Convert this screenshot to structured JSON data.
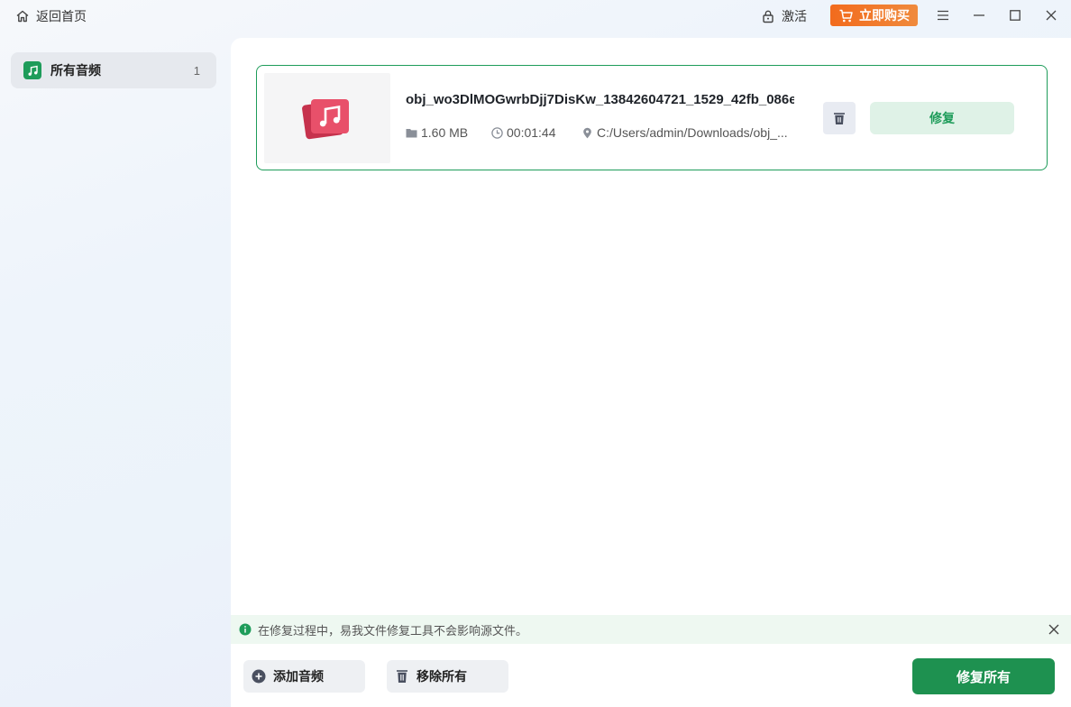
{
  "titlebar": {
    "home_label": "返回首页",
    "activate_label": "激活",
    "buy_label": "立即购买"
  },
  "sidebar": {
    "items": [
      {
        "label": "所有音频",
        "count": "1",
        "icon": "music-note-icon"
      }
    ]
  },
  "files": [
    {
      "name": "obj_wo3DlMOGwrbDjj7DisKw_13842604721_1529_42fb_086e",
      "size": "1.60 MB",
      "duration": "00:01:44",
      "path": "C:/Users/admin/Downloads/obj_...",
      "repair_label": "修复"
    }
  ],
  "info_bar": {
    "text": "在修复过程中，易我文件修复工具不会影响源文件。"
  },
  "actions": {
    "add_label": "添加音频",
    "remove_all_label": "移除所有",
    "repair_all_label": "修复所有"
  },
  "colors": {
    "accent_green": "#1e9c5a",
    "buy_orange": "#f26b1d",
    "music_pink": "#e8506a"
  }
}
